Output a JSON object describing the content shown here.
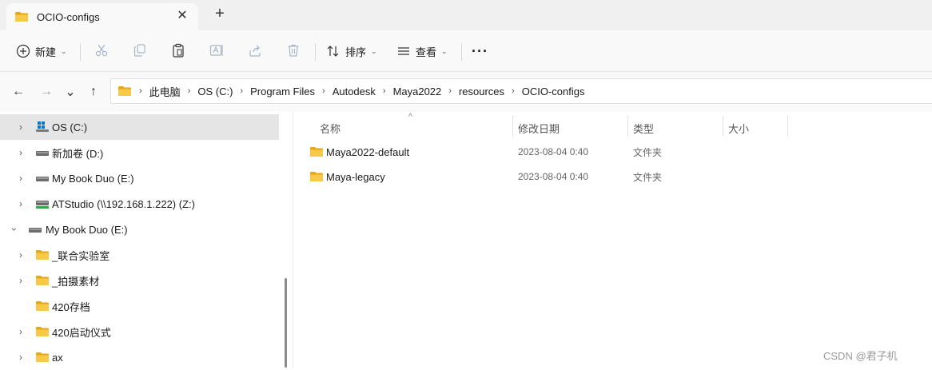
{
  "tab": {
    "title": "OCIO-configs",
    "close_glyph": "✕",
    "new_tab_glyph": "+"
  },
  "toolbar": {
    "new_label": "新建",
    "sort_label": "排序",
    "view_label": "查看",
    "more_glyph": "···",
    "caret": "⌄"
  },
  "nav": {
    "back": "←",
    "forward": "→",
    "recent": "⌄",
    "up": "↑"
  },
  "breadcrumb": {
    "separator": "›",
    "items": [
      "此电脑",
      "OS (C:)",
      "Program Files",
      "Autodesk",
      "Maya2022",
      "resources",
      "OCIO-configs"
    ]
  },
  "sidebar": {
    "items": [
      {
        "label": "OS (C:)",
        "icon": "windows-drive-icon"
      },
      {
        "label": "新加卷 (D:)",
        "icon": "drive-icon"
      },
      {
        "label": "My Book Duo (E:)",
        "icon": "drive-icon"
      },
      {
        "label": "ATStudio (\\\\192.168.1.222) (Z:)",
        "icon": "network-drive-icon"
      },
      {
        "label": "My Book Duo (E:)",
        "icon": "drive-icon"
      },
      {
        "label": "_联合实验室",
        "icon": "folder-icon"
      },
      {
        "label": "_拍摄素材",
        "icon": "folder-icon"
      },
      {
        "label": "420存档",
        "icon": "folder-icon"
      },
      {
        "label": "420启动仪式",
        "icon": "folder-icon"
      },
      {
        "label": "ax",
        "icon": "folder-icon"
      }
    ]
  },
  "columns": {
    "name": "名称",
    "modified": "修改日期",
    "type": "类型",
    "size": "大小",
    "sort_glyph": "^"
  },
  "files": [
    {
      "name": "Maya2022-default",
      "modified": "2023-08-04 0:40",
      "type": "文件夹"
    },
    {
      "name": "Maya-legacy",
      "modified": "2023-08-04 0:40",
      "type": "文件夹"
    }
  ],
  "watermark": "CSDN @君子机",
  "colors": {
    "folder": "#f8c948",
    "folder_dark": "#e6a817",
    "accent": "#0067c0"
  }
}
